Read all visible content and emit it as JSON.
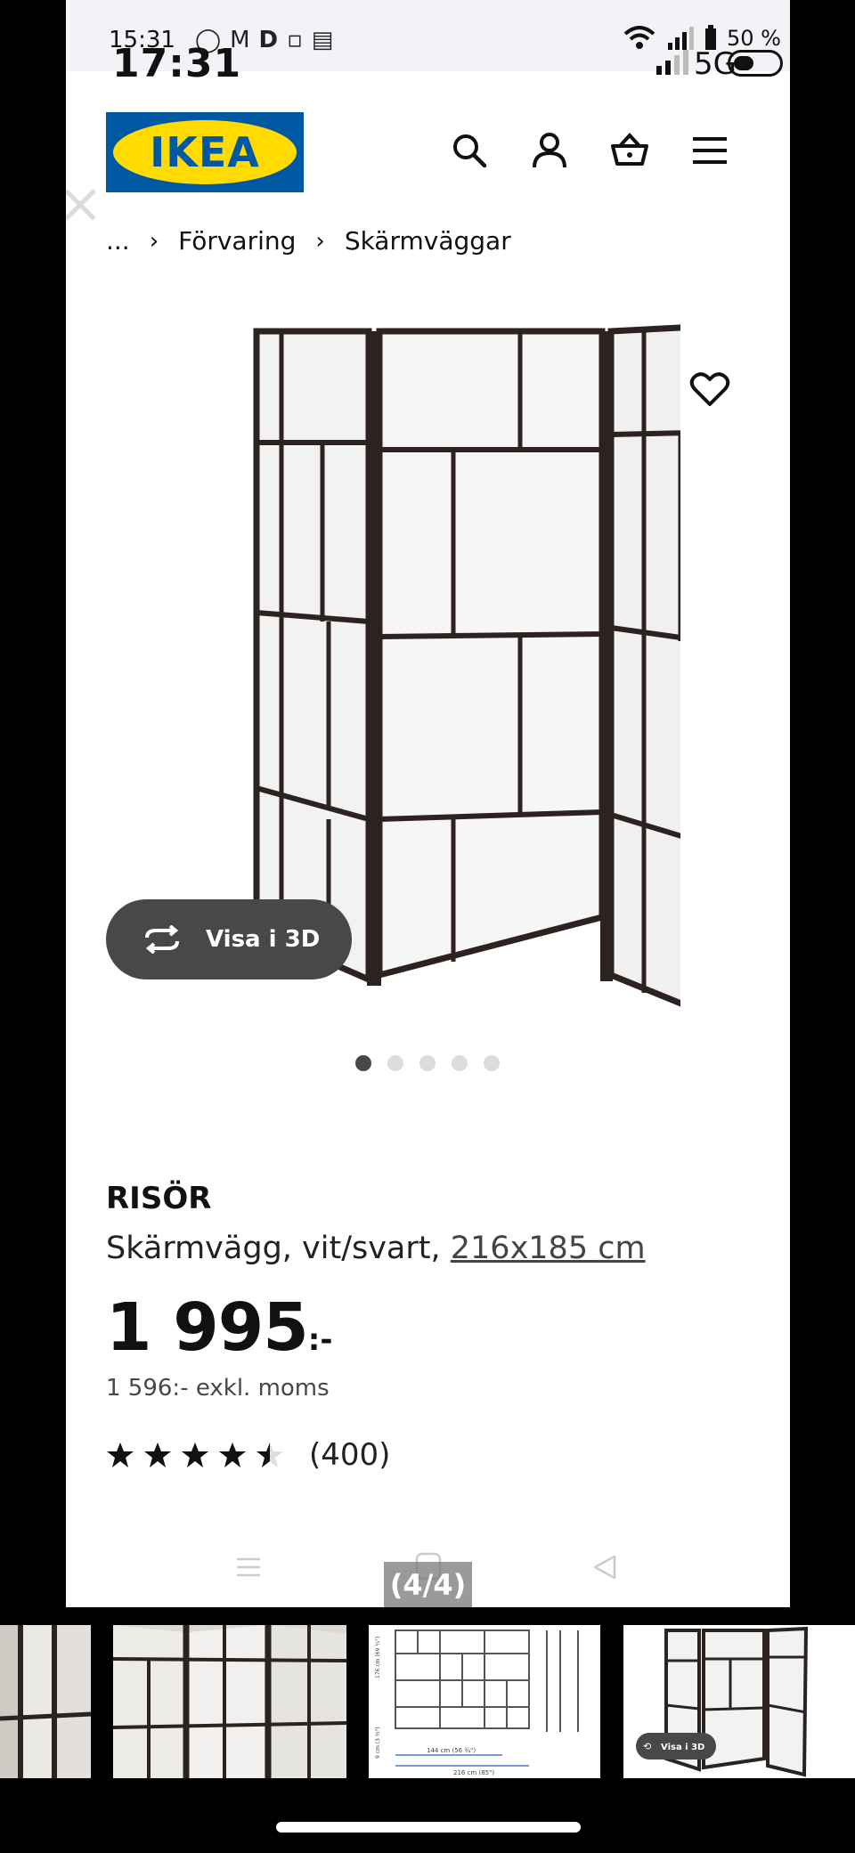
{
  "status_bar": {
    "time_small": "15:31",
    "time_big": "17:31",
    "battery_percent": "50 %",
    "network": "5G"
  },
  "header": {
    "logo_text": "IKEA",
    "brand_colors": {
      "blue": "#0058a3",
      "yellow": "#ffdb00"
    },
    "icons": [
      "search-icon",
      "account-icon",
      "basket-icon",
      "menu-icon"
    ]
  },
  "breadcrumb": {
    "items": [
      "...",
      "Förvaring",
      "Skärmväggar"
    ],
    "separator": "›"
  },
  "gallery": {
    "view_3d_label": "Visa i 3D",
    "dot_count": 5,
    "active_dot": 1
  },
  "product": {
    "name": "RISÖR",
    "description": "Skärmvägg, vit/svart,",
    "dimension_link": "216x185 cm",
    "price": "1 995",
    "price_suffix": ":-",
    "price_ex_vat": "1 596:- exkl. moms",
    "rating_value": 4.5,
    "rating_count": "(400)"
  },
  "viewer": {
    "page_indicator": "(4/4)"
  },
  "thumbnails": {
    "diagram_labels": [
      "176 cm (69 ¼\")",
      "9 cm (3 ½\")",
      "144 cm (56 ¾\")",
      "216 cm (85\")"
    ],
    "thumb_3d_label": "Visa i 3D"
  }
}
